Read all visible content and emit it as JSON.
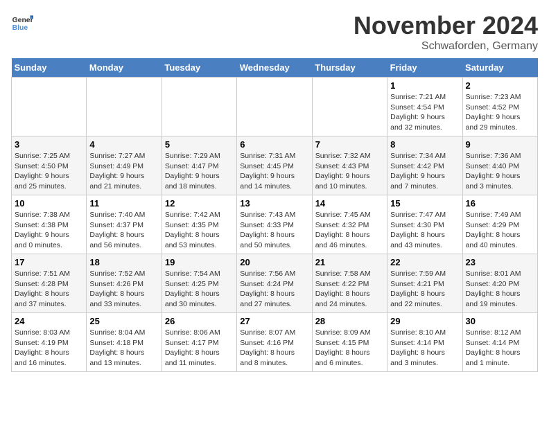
{
  "logo": {
    "line1": "General",
    "line2": "Blue"
  },
  "title": "November 2024",
  "location": "Schwaforden, Germany",
  "days_of_week": [
    "Sunday",
    "Monday",
    "Tuesday",
    "Wednesday",
    "Thursday",
    "Friday",
    "Saturday"
  ],
  "weeks": [
    [
      {
        "day": "",
        "info": ""
      },
      {
        "day": "",
        "info": ""
      },
      {
        "day": "",
        "info": ""
      },
      {
        "day": "",
        "info": ""
      },
      {
        "day": "",
        "info": ""
      },
      {
        "day": "1",
        "info": "Sunrise: 7:21 AM\nSunset: 4:54 PM\nDaylight: 9 hours\nand 32 minutes."
      },
      {
        "day": "2",
        "info": "Sunrise: 7:23 AM\nSunset: 4:52 PM\nDaylight: 9 hours\nand 29 minutes."
      }
    ],
    [
      {
        "day": "3",
        "info": "Sunrise: 7:25 AM\nSunset: 4:50 PM\nDaylight: 9 hours\nand 25 minutes."
      },
      {
        "day": "4",
        "info": "Sunrise: 7:27 AM\nSunset: 4:49 PM\nDaylight: 9 hours\nand 21 minutes."
      },
      {
        "day": "5",
        "info": "Sunrise: 7:29 AM\nSunset: 4:47 PM\nDaylight: 9 hours\nand 18 minutes."
      },
      {
        "day": "6",
        "info": "Sunrise: 7:31 AM\nSunset: 4:45 PM\nDaylight: 9 hours\nand 14 minutes."
      },
      {
        "day": "7",
        "info": "Sunrise: 7:32 AM\nSunset: 4:43 PM\nDaylight: 9 hours\nand 10 minutes."
      },
      {
        "day": "8",
        "info": "Sunrise: 7:34 AM\nSunset: 4:42 PM\nDaylight: 9 hours\nand 7 minutes."
      },
      {
        "day": "9",
        "info": "Sunrise: 7:36 AM\nSunset: 4:40 PM\nDaylight: 9 hours\nand 3 minutes."
      }
    ],
    [
      {
        "day": "10",
        "info": "Sunrise: 7:38 AM\nSunset: 4:38 PM\nDaylight: 9 hours\nand 0 minutes."
      },
      {
        "day": "11",
        "info": "Sunrise: 7:40 AM\nSunset: 4:37 PM\nDaylight: 8 hours\nand 56 minutes."
      },
      {
        "day": "12",
        "info": "Sunrise: 7:42 AM\nSunset: 4:35 PM\nDaylight: 8 hours\nand 53 minutes."
      },
      {
        "day": "13",
        "info": "Sunrise: 7:43 AM\nSunset: 4:33 PM\nDaylight: 8 hours\nand 50 minutes."
      },
      {
        "day": "14",
        "info": "Sunrise: 7:45 AM\nSunset: 4:32 PM\nDaylight: 8 hours\nand 46 minutes."
      },
      {
        "day": "15",
        "info": "Sunrise: 7:47 AM\nSunset: 4:30 PM\nDaylight: 8 hours\nand 43 minutes."
      },
      {
        "day": "16",
        "info": "Sunrise: 7:49 AM\nSunset: 4:29 PM\nDaylight: 8 hours\nand 40 minutes."
      }
    ],
    [
      {
        "day": "17",
        "info": "Sunrise: 7:51 AM\nSunset: 4:28 PM\nDaylight: 8 hours\nand 37 minutes."
      },
      {
        "day": "18",
        "info": "Sunrise: 7:52 AM\nSunset: 4:26 PM\nDaylight: 8 hours\nand 33 minutes."
      },
      {
        "day": "19",
        "info": "Sunrise: 7:54 AM\nSunset: 4:25 PM\nDaylight: 8 hours\nand 30 minutes."
      },
      {
        "day": "20",
        "info": "Sunrise: 7:56 AM\nSunset: 4:24 PM\nDaylight: 8 hours\nand 27 minutes."
      },
      {
        "day": "21",
        "info": "Sunrise: 7:58 AM\nSunset: 4:22 PM\nDaylight: 8 hours\nand 24 minutes."
      },
      {
        "day": "22",
        "info": "Sunrise: 7:59 AM\nSunset: 4:21 PM\nDaylight: 8 hours\nand 22 minutes."
      },
      {
        "day": "23",
        "info": "Sunrise: 8:01 AM\nSunset: 4:20 PM\nDaylight: 8 hours\nand 19 minutes."
      }
    ],
    [
      {
        "day": "24",
        "info": "Sunrise: 8:03 AM\nSunset: 4:19 PM\nDaylight: 8 hours\nand 16 minutes."
      },
      {
        "day": "25",
        "info": "Sunrise: 8:04 AM\nSunset: 4:18 PM\nDaylight: 8 hours\nand 13 minutes."
      },
      {
        "day": "26",
        "info": "Sunrise: 8:06 AM\nSunset: 4:17 PM\nDaylight: 8 hours\nand 11 minutes."
      },
      {
        "day": "27",
        "info": "Sunrise: 8:07 AM\nSunset: 4:16 PM\nDaylight: 8 hours\nand 8 minutes."
      },
      {
        "day": "28",
        "info": "Sunrise: 8:09 AM\nSunset: 4:15 PM\nDaylight: 8 hours\nand 6 minutes."
      },
      {
        "day": "29",
        "info": "Sunrise: 8:10 AM\nSunset: 4:14 PM\nDaylight: 8 hours\nand 3 minutes."
      },
      {
        "day": "30",
        "info": "Sunrise: 8:12 AM\nSunset: 4:14 PM\nDaylight: 8 hours\nand 1 minute."
      }
    ]
  ]
}
